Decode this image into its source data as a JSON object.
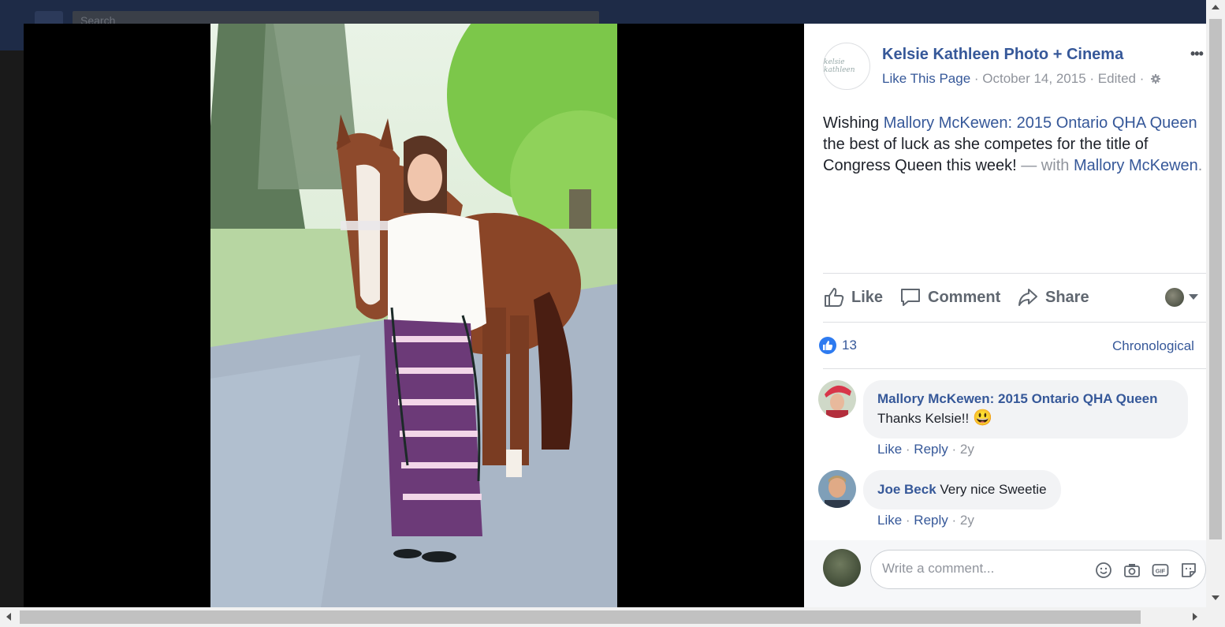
{
  "topbar": {
    "search_placeholder": "Search"
  },
  "post": {
    "page_name": "Kelsie Kathleen Photo + Cinema",
    "page_logo_text": "kelsie kathleen",
    "like_page": "Like This Page",
    "date": "October 14, 2015",
    "edited": "Edited",
    "text": {
      "before": "Wishing ",
      "mention1": "Mallory McKewen: 2015 Ontario QHA Queen",
      "middle": " the best of luck as she competes for the title of Congress Queen this week!",
      "with_prefix": " — with ",
      "mention2": "Mallory McKewen",
      "end": "."
    }
  },
  "actions": {
    "like": "Like",
    "comment": "Comment",
    "share": "Share"
  },
  "reactions": {
    "count": "13",
    "sort": "Chronological"
  },
  "comments": [
    {
      "author": "Mallory McKewen: 2015 Ontario QHA Queen",
      "text": " Thanks Kelsie!! ",
      "emoji": "😃",
      "like": "Like",
      "reply": "Reply",
      "time": "2y"
    },
    {
      "author": "Joe Beck",
      "text": " Very nice Sweetie",
      "like": "Like",
      "reply": "Reply",
      "time": "2y"
    }
  ],
  "composer": {
    "placeholder": "Write a comment..."
  },
  "icons": [
    "gear-icon",
    "like-icon",
    "comment-icon",
    "share-icon",
    "emoji-icon",
    "camera-icon",
    "gif-icon",
    "sticker-icon"
  ],
  "colors": {
    "link": "#365899",
    "muted": "#90949c",
    "like_badge": "#2e7bf0"
  }
}
